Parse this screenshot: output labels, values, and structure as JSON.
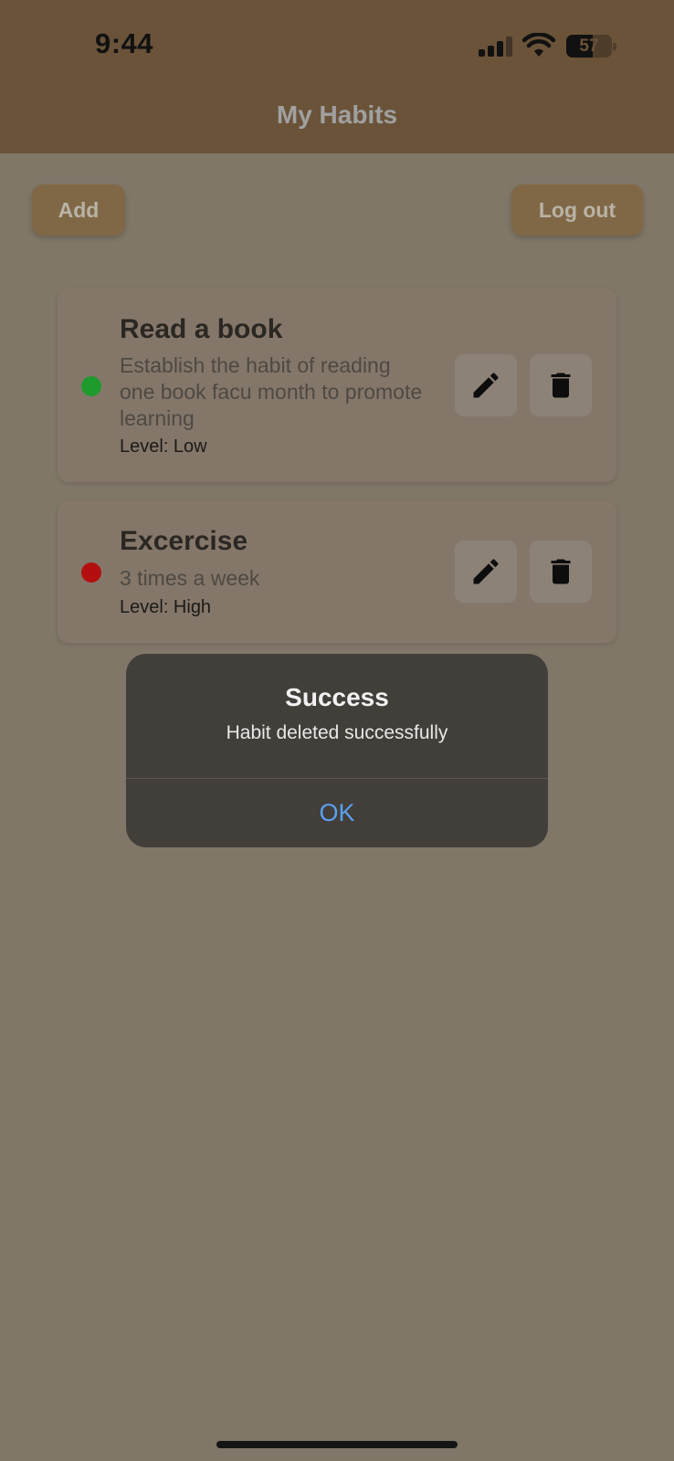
{
  "status_bar": {
    "time": "9:44",
    "battery": "57",
    "battery_level": 0.57,
    "icons": [
      "cellular-signal-icon",
      "wifi-icon",
      "battery-icon"
    ]
  },
  "header": {
    "title": "My Habits"
  },
  "toolbar": {
    "add_label": "Add",
    "logout_label": "Log out"
  },
  "habits": [
    {
      "title": "Read a book",
      "description": "Establish the habit of reading one book facu month to promote learning",
      "level": "Level: Low",
      "status_color": "#1f9a2c"
    },
    {
      "title": "Excercise",
      "description": "3 times a week",
      "level": "Level: High",
      "status_color": "#b30f0f"
    }
  ],
  "alert": {
    "title": "Success",
    "message": "Habit deleted successfully",
    "ok_label": "OK"
  },
  "colors": {
    "header": "#6a5339",
    "button": "#806846",
    "overlay_bg": "#807768",
    "alert_bg": "#423e39",
    "alert_action": "#5aa0ef"
  }
}
